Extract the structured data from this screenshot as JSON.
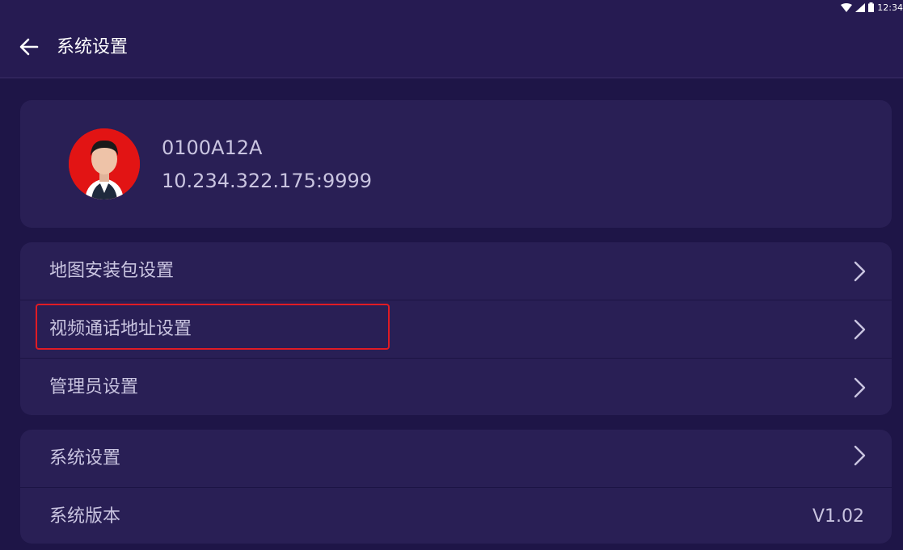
{
  "status_bar": {
    "time": "12:34",
    "icons": [
      "wifi-icon",
      "signal-icon",
      "battery-icon"
    ]
  },
  "header": {
    "title": "系统设置",
    "back_icon": "arrow-left-icon"
  },
  "profile": {
    "device_id": "0100A12A",
    "address": "10.234.322.175:9999",
    "avatar_bg": "#e21414"
  },
  "menu_group_1": {
    "items": [
      {
        "label": "地图安装包设置"
      },
      {
        "label": "视频通话地址设置"
      },
      {
        "label": "管理员设置"
      }
    ]
  },
  "menu_group_2": {
    "items": [
      {
        "label": "系统设置"
      },
      {
        "label": "系统版本",
        "value": "V1.02"
      }
    ]
  },
  "colors": {
    "background": "#1e1547",
    "card": "#291f55",
    "header": "#261b52",
    "highlight": "#e01b24",
    "text": "#c9c4e0"
  }
}
